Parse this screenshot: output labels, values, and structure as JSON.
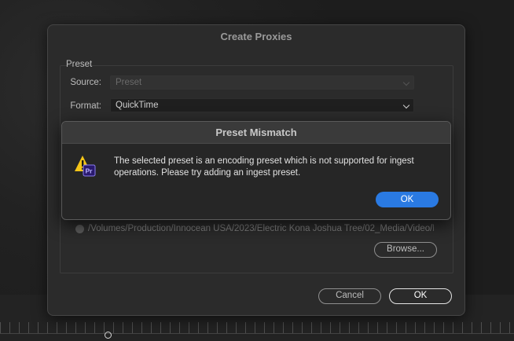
{
  "dialog": {
    "title": "Create Proxies",
    "group_label": "Preset",
    "source_label": "Source:",
    "source_value": "Preset",
    "format_label": "Format:",
    "format_value": "QuickTime",
    "path": "/Volumes/Production/Innocean USA/2023/Electric Kona Joshua Tree/02_Media/Video/P...",
    "browse_label": "Browse...",
    "cancel_label": "Cancel",
    "ok_label": "OK"
  },
  "alert": {
    "title": "Preset Mismatch",
    "icon_badge": "Pr",
    "message": "The selected preset is an encoding preset which is not supported for ingest operations. Please try adding an ingest preset.",
    "ok_label": "OK"
  },
  "colors": {
    "accent": "#2a7ae2",
    "warning": "#f5c518",
    "premiere_badge": "#2a1a6e"
  }
}
